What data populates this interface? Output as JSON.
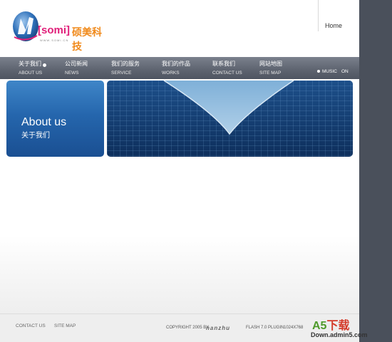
{
  "header": {
    "logo_brand": "[somi]",
    "logo_cn": "硕美科技",
    "logo_url": "WWW.SOMI.CN",
    "home_label": "Home"
  },
  "nav": {
    "items": [
      {
        "cn": "关于我们",
        "en": "ABOUT US"
      },
      {
        "cn": "公司新闻",
        "en": "NEWS"
      },
      {
        "cn": "我们的服务",
        "en": "SERVICE"
      },
      {
        "cn": "我们的作品",
        "en": "WORKS"
      },
      {
        "cn": "联系我们",
        "en": "CONTACT US"
      },
      {
        "cn": "网站地图",
        "en": "SITE MAP"
      }
    ],
    "music_label": "MUSIC",
    "music_state": "ON"
  },
  "banner": {
    "title_en": "About us",
    "title_cn": "关于我们"
  },
  "footer": {
    "contact_label": "CONTACT US",
    "sitemap_label": "SITE MAP",
    "copyright": "COPYRIGHT 2005 BY",
    "designer_logo": "nanzhu",
    "flash_note": "FLASH 7.0 PLUGIN",
    "resolution": "1024X768"
  },
  "watermark": {
    "brand_a5": "A5",
    "brand_xz": "下载",
    "url": "Down.admin5.com"
  },
  "colors": {
    "nav_bg": "#5d636f",
    "about_blue": "#2566ad",
    "side_panel": "#4a505b",
    "logo_pink": "#e0207a",
    "logo_orange": "#f08a1c"
  }
}
